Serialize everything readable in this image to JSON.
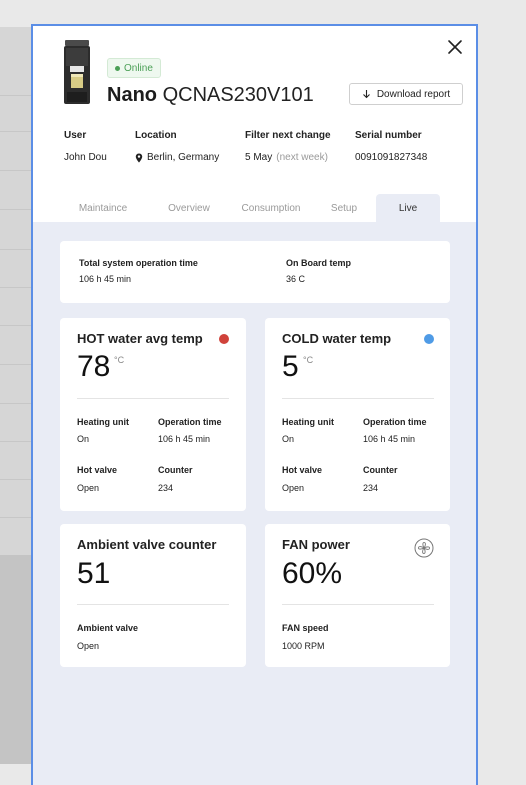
{
  "header": {
    "status": "Online",
    "brand": "Nano",
    "model": "QCNAS230V101",
    "download_label": "Download report"
  },
  "info": {
    "user": {
      "label": "User",
      "value": "John Dou"
    },
    "location": {
      "label": "Location",
      "value": "Berlin, Germany"
    },
    "filter": {
      "label": "Filter next change",
      "value": "5 May",
      "note": "(next week)"
    },
    "serial": {
      "label": "Serial number",
      "value": "0091091827348"
    }
  },
  "tabs": [
    {
      "label": "Maintaince"
    },
    {
      "label": "Overview"
    },
    {
      "label": "Consumption"
    },
    {
      "label": "Setup"
    },
    {
      "label": "Live"
    }
  ],
  "active_tab": "Live",
  "summary": {
    "operation": {
      "label": "Total system operation time",
      "value": "106 h 45 min"
    },
    "onboard": {
      "label": "On Board temp",
      "value": "36 C"
    }
  },
  "hot": {
    "title": "HOT water avg temp",
    "value": "78",
    "unit": "°C",
    "indicator_color": "#d0423a",
    "heating_label": "Heating unit",
    "heating_value": "On",
    "optime_label": "Operation time",
    "optime_value": "106 h 45 min",
    "valve_label": "Hot valve",
    "valve_value": "Open",
    "counter_label": "Counter",
    "counter_value": "234"
  },
  "cold": {
    "title": "COLD water temp",
    "value": "5",
    "unit": "°C",
    "indicator_color": "#4f9be6",
    "heating_label": "Heating unit",
    "heating_value": "On",
    "optime_label": "Operation time",
    "optime_value": "106 h 45 min",
    "valve_label": "Hot valve",
    "valve_value": "Open",
    "counter_label": "Counter",
    "counter_value": "234"
  },
  "ambient": {
    "title": "Ambient valve counter",
    "value": "51",
    "valve_label": "Ambient valve",
    "valve_value": "Open"
  },
  "fan": {
    "title": "FAN power",
    "value": "60%",
    "speed_label": "FAN speed",
    "speed_value": "1000 RPM",
    "icon": "fan-icon"
  },
  "colors": {
    "accent_border": "#5b8ee6",
    "online": "#4a9f56",
    "content_bg": "#e9ecf5"
  }
}
